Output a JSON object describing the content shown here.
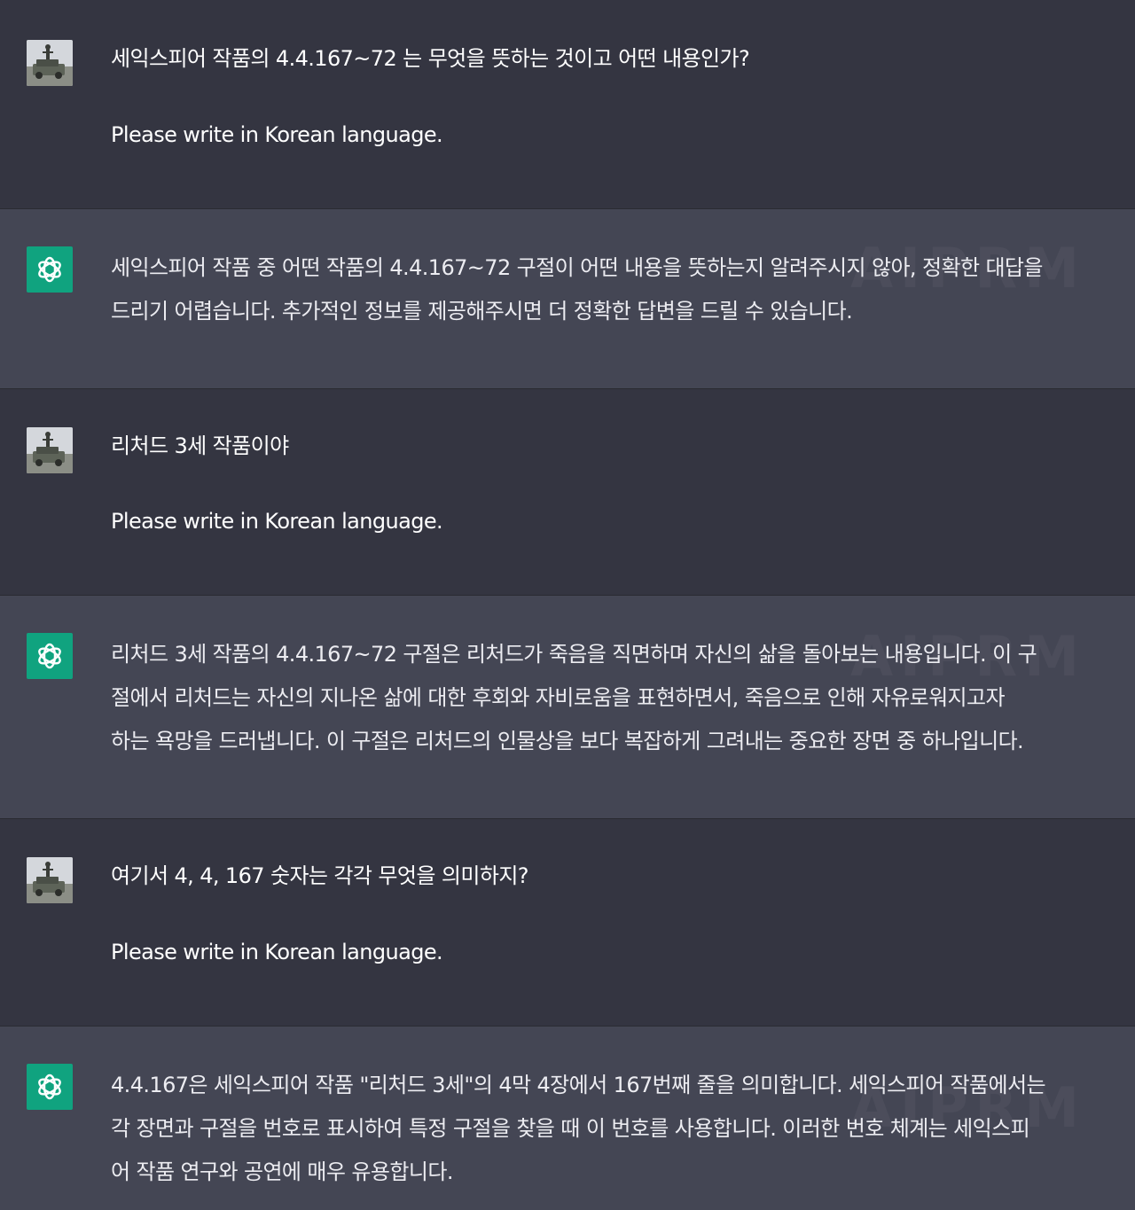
{
  "colors": {
    "user_bg": "#343541",
    "assistant_bg": "#444654",
    "assistant_avatar": "#10a37f",
    "text": "#ececf1"
  },
  "icons": {
    "user_avatar": "user-photo-avatar",
    "assistant_avatar": "openai-logo-icon"
  },
  "watermark": "AIPRM",
  "messages": [
    {
      "role": "user",
      "lines": [
        "세익스피어 작품의 4.4.167~72 는 무엇을 뜻하는 것이고 어떤 내용인가?",
        "Please write in Korean language."
      ]
    },
    {
      "role": "assistant",
      "lines": [
        "세익스피어 작품 중 어떤 작품의 4.4.167~72 구절이 어떤 내용을 뜻하는지 알려주시지 않아, 정확한 대답을",
        "드리기 어렵습니다. 추가적인 정보를 제공해주시면 더 정확한 답변을 드릴 수 있습니다."
      ]
    },
    {
      "role": "user",
      "lines": [
        "리처드 3세 작품이야",
        "Please write in Korean language."
      ]
    },
    {
      "role": "assistant",
      "lines": [
        "리처드 3세 작품의 4.4.167~72 구절은 리처드가 죽음을 직면하며 자신의 삶을 돌아보는 내용입니다. 이 구",
        "절에서 리처드는 자신의 지나온 삶에 대한 후회와 자비로움을 표현하면서, 죽음으로 인해 자유로워지고자",
        "하는 욕망을 드러냅니다. 이 구절은 리처드의 인물상을 보다 복잡하게 그려내는 중요한 장면 중 하나입니다."
      ]
    },
    {
      "role": "user",
      "lines": [
        "여기서 4, 4, 167 숫자는 각각 무엇을 의미하지?",
        "Please write in Korean language."
      ]
    },
    {
      "role": "assistant",
      "lines": [
        "4.4.167은 세익스피어 작품 \"리처드 3세\"의 4막 4장에서 167번째 줄을 의미합니다. 세익스피어 작품에서는",
        "각 장면과 구절을 번호로 표시하여 특정 구절을 찾을 때 이 번호를 사용합니다. 이러한 번호 체계는 세익스피",
        "어 작품 연구와 공연에 매우 유용합니다."
      ]
    }
  ]
}
